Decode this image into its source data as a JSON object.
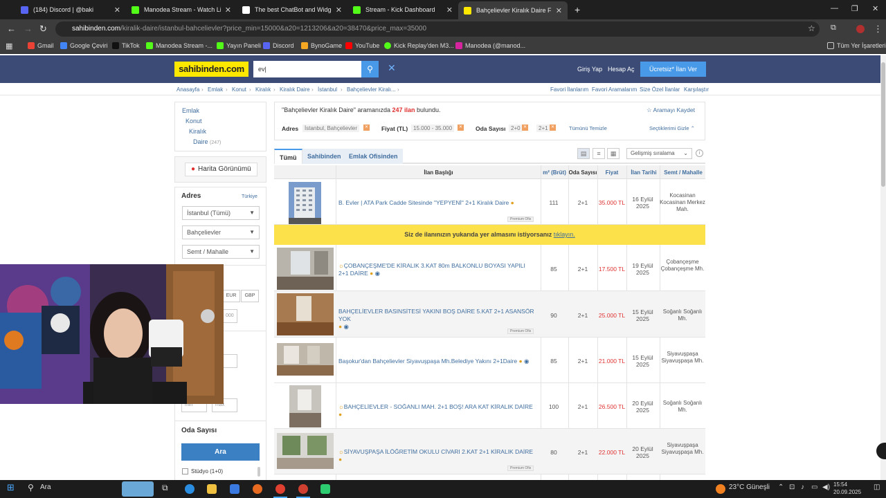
{
  "browser": {
    "tabs": [
      {
        "label": "(184) Discord | @baki",
        "color": "#5865f2"
      },
      {
        "label": "Manodea Stream - Watch Live",
        "color": "#53fc18"
      },
      {
        "label": "The best ChatBot and Widgets",
        "color": "#ffffff"
      },
      {
        "label": "Stream - Kick Dashboard",
        "color": "#53fc18"
      },
      {
        "label": "Bahçelievler Kiralık Daire Fiyatl",
        "color": "#ffe800"
      }
    ],
    "new_tab": "+",
    "url_domain": "sahibinden.com",
    "url_path": "/kiralik-daire/istanbul-bahcelievler?price_min=15000&a20=1213206&a20=38470&price_max=35000",
    "bookmarks": [
      "Gmail",
      "Google Çeviri",
      "TikTok",
      "Manodea Stream -...",
      "Yayın Paneli",
      "Discord",
      "BynoGame",
      "YouTube",
      "Kick Replay'den M3...",
      "Manodea (@manod..."
    ],
    "all_bookmarks": "Tüm Yer İşaretleri",
    "window_min": "—",
    "window_max": "❐",
    "window_close": "✕"
  },
  "site": {
    "logo": "sahibinden.com",
    "search_value": "ev",
    "login": "Giriş Yap",
    "register": "Hesap Aç",
    "post_ad": "Ücretsiz* İlan Ver",
    "breadcrumbs": [
      "Anasayfa",
      "Emlak",
      "Konut",
      "Kiralık",
      "Kiralık Daire",
      "İstanbul",
      "Bahçelievler Kiralı..."
    ],
    "top_links": [
      "Favori İlanlarım",
      "Favori Aramalarım",
      "Size Özel İlanlar",
      "Karşılaştır"
    ]
  },
  "sidebar": {
    "categories": [
      {
        "label": "Emlak",
        "count": ""
      },
      {
        "label": "Konut",
        "count": ""
      },
      {
        "label": "Kiralık",
        "count": ""
      },
      {
        "label": "Daire",
        "count": "(247)"
      }
    ],
    "map_view": "Harita Görünümü",
    "address_label": "Adres",
    "address_country": "Türkiye",
    "city": "İstanbul (Tümü)",
    "district": "Bahçelievler",
    "neighborhood": "Semt / Mahalle",
    "currency_eur": "EUR",
    "currency_gbp": "GBP",
    "price_max_partial": "000",
    "min_placeholder": "min",
    "max_placeholder": "max",
    "rooms_label": "Oda Sayısı",
    "search_button": "Ara",
    "studio_option": "Stüdyo (1+0)"
  },
  "results": {
    "query": "\"Bahçelievler Kiralık Daire\"",
    "summary_mid": " aramanızda ",
    "count": "247 ilan",
    "summary_end": " bulundu.",
    "save_search": "Aramayı Kaydet",
    "filter_address_label": "Adres",
    "filter_address_value": "İstanbul, Bahçelievler",
    "filter_price_label": "Fiyat (TL)",
    "filter_price_value": "15.000 - 35.000",
    "filter_rooms_label": "Oda Sayısı",
    "filter_rooms_1": "2+0",
    "filter_rooms_2": "2+1",
    "clear_all": "Tümünü Temizle",
    "hide_selected": "Seçtiklerimi Gizle",
    "tabs": [
      "Tümü",
      "Sahibinden",
      "Emlak Ofisinden"
    ],
    "sort": "Gelişmiş sıralama",
    "columns": {
      "title": "İlan Başlığı",
      "m2": "m² (Brüt)",
      "rooms": "Oda Sayısı",
      "price": "Fiyat",
      "date": "İlan Tarihi",
      "location": "Semt / Mahalle"
    },
    "promo_text": "Siz de ilanınızın yukarıda yer almasını istiyorsanız ",
    "promo_link": "tıklayın.",
    "premium_label": "Premium Ofis",
    "listings": [
      {
        "title": "B. Evler | ATA Park Cadde Sitesinde \"YEPYENİ\" 2+1 Kiralık Daire",
        "m2": "111",
        "rooms": "2+1",
        "price": "35.000 TL",
        "date": "16 Eylül 2025",
        "loc": "Kocasinan Kocasinan Merkez Mah."
      },
      {
        "title": "ÇOBANÇEŞME'DE KİRALIK 3.KAT 80m BALKONLU BOYASI YAPILI 2+1 DAİRE",
        "m2": "85",
        "rooms": "2+1",
        "price": "17.500 TL",
        "date": "19 Eylül 2025",
        "loc": "Çobançeşme Çobançeşme Mh."
      },
      {
        "title": "BAHÇELİEVLER BASINSİTESİ YAKINI BOŞ DAİRE 5.KAT 2+1 ASANSÖR YOK",
        "m2": "90",
        "rooms": "2+1",
        "price": "25.000 TL",
        "date": "15 Eylül 2025",
        "loc": "Soğanlı Soğanlı Mh."
      },
      {
        "title": "Başokur'dan Bahçelievler Siyavuşpaşa Mh.Belediye Yakını 2+1Daire",
        "m2": "85",
        "rooms": "2+1",
        "price": "21.000 TL",
        "date": "15 Eylül 2025",
        "loc": "Siyavuşpaşa Siyavuşpaşa Mh."
      },
      {
        "title": "BAHÇELİEVLER - SOĞANLI MAH. 2+1 BOŞ! ARA KAT KİRALIK DAİRE",
        "m2": "100",
        "rooms": "2+1",
        "price": "26.500 TL",
        "date": "20 Eylül 2025",
        "loc": "Soğanlı Soğanlı Mh."
      },
      {
        "title": "SİYAVUŞPAŞA İLÖĞRETİM OKULU CİVARI 2.KAT 2+1 KİRALIK DAİRE",
        "m2": "80",
        "rooms": "2+1",
        "price": "22.000 TL",
        "date": "20 Eylül 2025",
        "loc": "Siyavuşpaşa Siyavuşpaşa Mh."
      }
    ]
  },
  "taskbar": {
    "search": "Ara",
    "weather": "23°C Güneşli",
    "time": "15:54",
    "date": "20.09.2025"
  }
}
